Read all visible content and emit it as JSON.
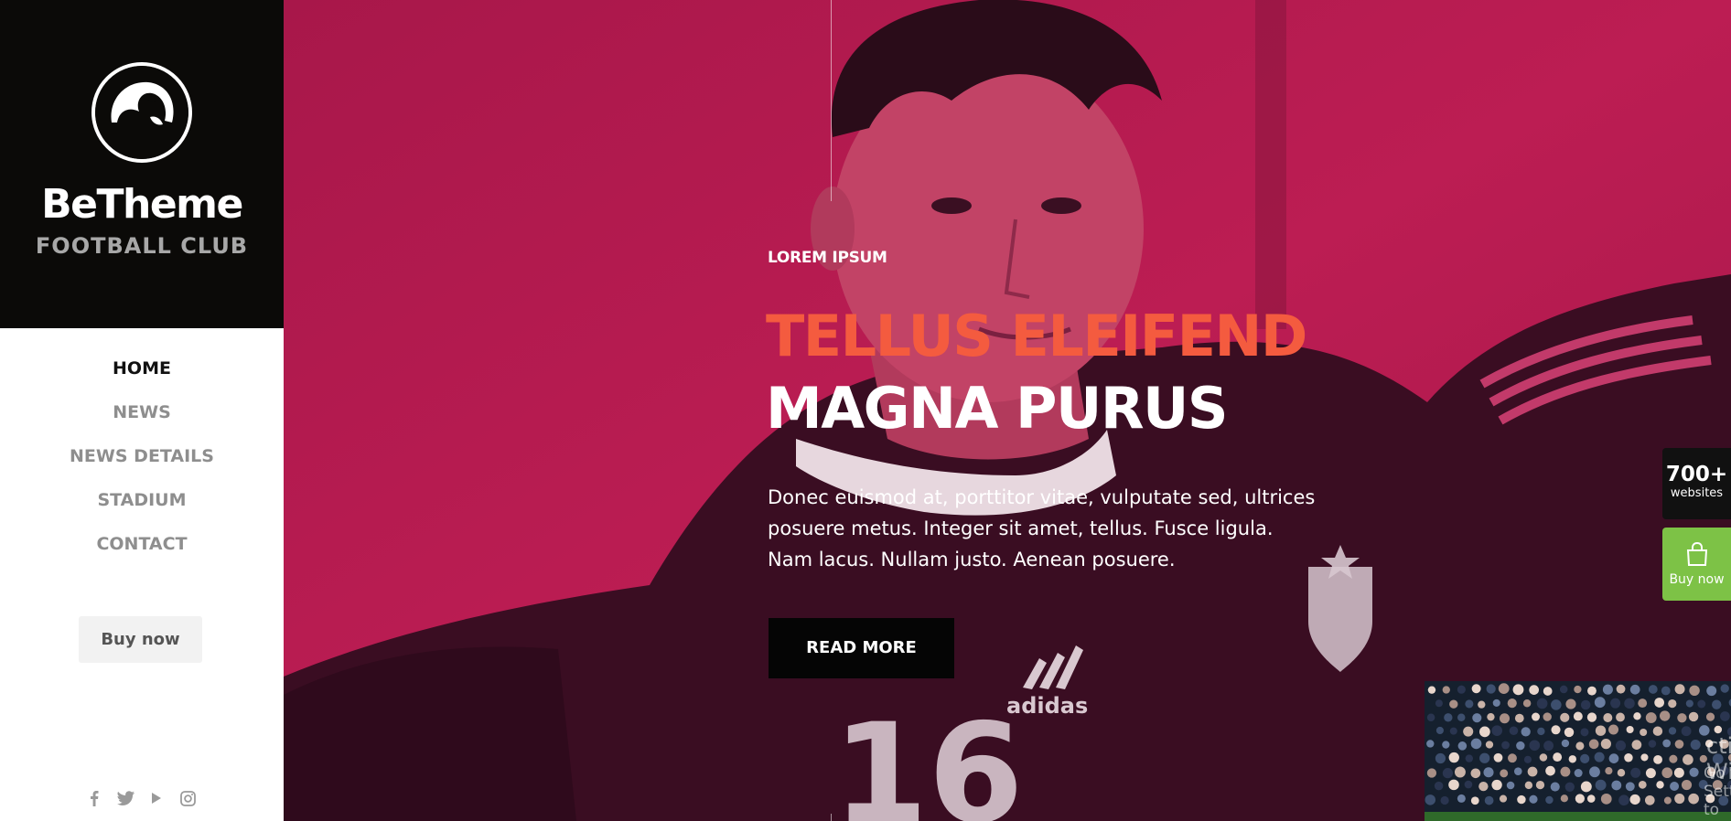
{
  "brand": {
    "name": "BeTheme",
    "subtitle": "FOOTBALL CLUB"
  },
  "nav": {
    "items": [
      {
        "label": "HOME",
        "active": true
      },
      {
        "label": "NEWS",
        "active": false
      },
      {
        "label": "NEWS DETAILS",
        "active": false
      },
      {
        "label": "STADIUM",
        "active": false
      },
      {
        "label": "CONTACT",
        "active": false
      }
    ]
  },
  "sidebar_button": {
    "label": "Buy now"
  },
  "social": {
    "icons": [
      "facebook-icon",
      "twitter-icon",
      "youtube-icon",
      "instagram-icon"
    ]
  },
  "hero": {
    "eyebrow": "LOREM IPSUM",
    "heading_line1": "TELLUS ELEIFEND",
    "heading_line2": "MAGNA PURUS",
    "body_lines": [
      "Donec euismod at, porttitor vitae, vulputate sed, ultrices",
      "posuere metus. Integer sit amet, tellus. Fusce ligula.",
      "Nam lacus. Nullam justo. Aenean posuere."
    ],
    "button": "READ MORE",
    "jersey_text": "adidas",
    "jersey_number": "16"
  },
  "floating": {
    "websites_count": "700+",
    "websites_label": "websites",
    "buy_label": "Buy now"
  },
  "watermark": {
    "line1": "ctivate Windows",
    "line2": "Go to Settings to activate Windows."
  },
  "colors": {
    "accent_orange": "#f45b3f",
    "hero_magenta": "#b41a4f",
    "sidebar_dark": "#0b0a08",
    "buy_green": "#7dc246"
  }
}
